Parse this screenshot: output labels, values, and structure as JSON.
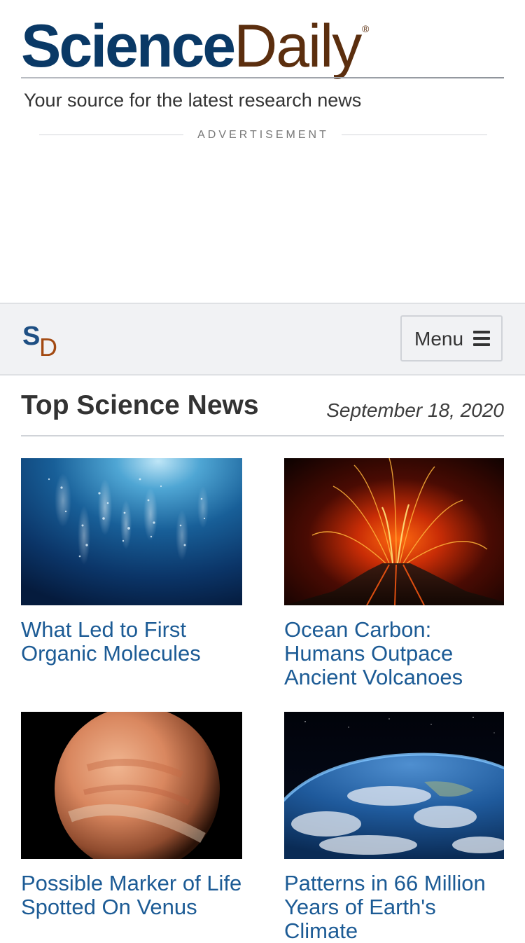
{
  "site": {
    "logo_science": "Science",
    "logo_daily": "Daily",
    "logo_reg": "®",
    "tagline": "Your source for the latest research news",
    "ad_label": "ADVERTISEMENT"
  },
  "nav": {
    "mini_logo_s": "S",
    "mini_logo_d": "D",
    "menu_label": "Menu",
    "menu_icon": "hamburger-icon"
  },
  "section": {
    "title": "Top Science News",
    "date": "September 18, 2020"
  },
  "stories": [
    {
      "headline": "What Led to First Organic Molecules",
      "image": "underwater-bubbles-image"
    },
    {
      "headline": "Ocean Carbon: Humans Outpace Ancient Volcanoes",
      "image": "erupting-volcano-image"
    },
    {
      "headline": "Possible Marker of Life Spotted On Venus",
      "image": "planet-venus-image"
    },
    {
      "headline": "Patterns in 66 Million Years of Earth's Climate",
      "image": "earth-from-orbit-image"
    }
  ],
  "colors": {
    "brand_navy": "#0a3966",
    "brand_brown": "#5b2e0e",
    "link_blue": "#1c5b95",
    "nav_bg": "#f1f2f4"
  }
}
